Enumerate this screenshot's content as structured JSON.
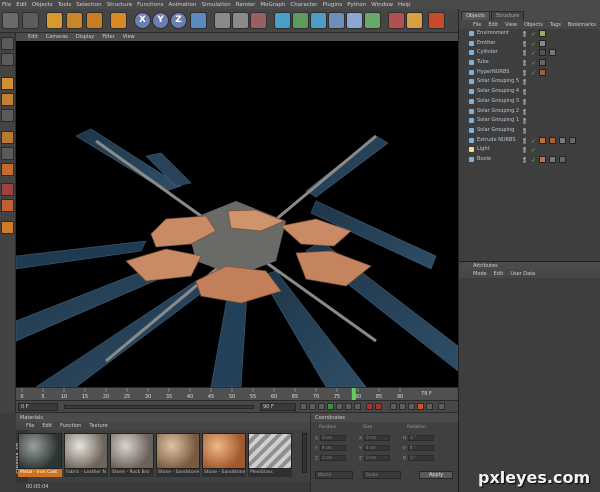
{
  "menubar": {
    "items": [
      "File",
      "Edit",
      "Objects",
      "Tools",
      "Selection",
      "Structure",
      "Functions",
      "Animation",
      "Simulation",
      "Render",
      "MoGraph",
      "Character",
      "Plugins",
      "Python",
      "Window",
      "Help"
    ]
  },
  "toolbar": {
    "x_label": "X",
    "y_label": "Y",
    "z_label": "Z"
  },
  "viewport": {
    "menu": [
      "Edit",
      "Cameras",
      "Display",
      "Filter",
      "View"
    ]
  },
  "timeline": {
    "ticks": [
      "0",
      "5",
      "10",
      "15",
      "20",
      "25",
      "30",
      "35",
      "40",
      "45",
      "50",
      "55",
      "60",
      "65",
      "70",
      "75",
      "80",
      "85",
      "90"
    ],
    "playhead_frame": "79",
    "end_label": "79 F",
    "start_field": "0 F",
    "end_field": "90 F"
  },
  "materials": {
    "title": "Materials",
    "menu": [
      "File",
      "Edit",
      "Function",
      "Texture"
    ],
    "items": [
      {
        "label": "Metal - Iron Cast",
        "selected": true
      },
      {
        "label": "Fabric - Leather N",
        "selected": false
      },
      {
        "label": "Stone - Rock Bro",
        "selected": false
      },
      {
        "label": "Stone - Sandstone",
        "selected": false
      },
      {
        "label": "Stone - Sandstone",
        "selected": false
      },
      {
        "label": "PlexiGlass",
        "selected": false
      }
    ],
    "brand": "CINEMA 4D"
  },
  "coordinates": {
    "title": "Coordinates",
    "position_header": "Position",
    "size_header": "Size",
    "rotation_header": "Rotation",
    "rows": [
      {
        "a": "X",
        "av": "0 cm",
        "b": "X",
        "bv": "0 cm",
        "c": "H",
        "cv": "0 °"
      },
      {
        "a": "Y",
        "av": "0 cm",
        "b": "Y",
        "bv": "0 cm",
        "c": "P",
        "cv": "0 °"
      },
      {
        "a": "Z",
        "av": "0 cm",
        "b": "Z",
        "bv": "0 cm",
        "c": "B",
        "cv": "0 °"
      }
    ],
    "mode": "World",
    "scale": "Scale",
    "apply": "Apply"
  },
  "status": {
    "time": "00:00:04"
  },
  "objects": {
    "tabs": [
      "Objects",
      "Structure"
    ],
    "menu": [
      "File",
      "Edit",
      "View",
      "Objects",
      "Tags",
      "Bookmarks"
    ],
    "items": [
      {
        "name": "Environment"
      },
      {
        "name": "Emitter"
      },
      {
        "name": "Cylinder"
      },
      {
        "name": "Tube"
      },
      {
        "name": "HyperNURBS"
      },
      {
        "name": "Solar Grouping 5"
      },
      {
        "name": "Solar Grouping 4"
      },
      {
        "name": "Solar Grouping 3"
      },
      {
        "name": "Solar Grouping 2"
      },
      {
        "name": "Solar Grouping 1"
      },
      {
        "name": "Solar Grouping"
      },
      {
        "name": "Extrude NURBS"
      },
      {
        "name": "Light"
      },
      {
        "name": "Boole"
      }
    ]
  },
  "attributes": {
    "title": "Attributes",
    "menu": [
      "Mode",
      "Edit",
      "User Data"
    ]
  },
  "watermark": "pxleyes.com",
  "colors": {
    "accent": "#d1721f",
    "viewport_bg": "#000000",
    "panel": "#3e3e3e",
    "tile": "#c98b66"
  }
}
